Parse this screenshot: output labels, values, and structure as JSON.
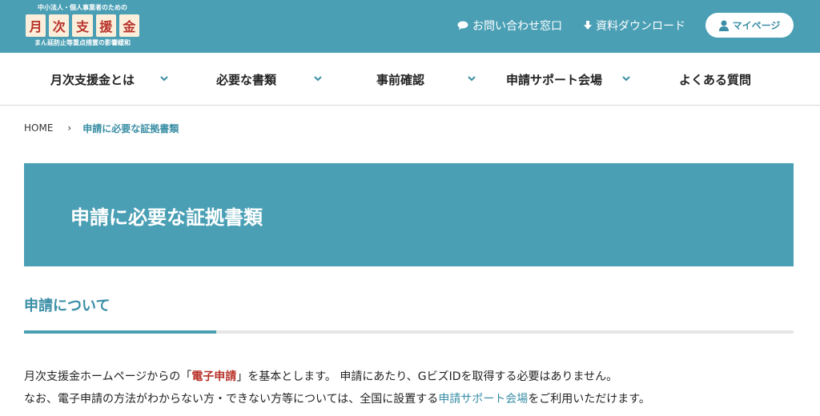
{
  "header": {
    "logo": {
      "top_text": "中小法人・個人事業者のための",
      "chars": [
        "月",
        "次",
        "支",
        "援",
        "金"
      ],
      "bottom_text": "まん延防止等重点措置の影響緩和"
    },
    "contact_label": "お問い合わせ窓口",
    "download_label": "資料ダウンロード",
    "mypage_label": "マイページ"
  },
  "nav": {
    "items": [
      {
        "label": "月次支援金とは",
        "has_dropdown": true
      },
      {
        "label": "必要な書類",
        "has_dropdown": true
      },
      {
        "label": "事前確認",
        "has_dropdown": true
      },
      {
        "label": "申請サポート会場",
        "has_dropdown": true
      },
      {
        "label": "よくある質問",
        "has_dropdown": false
      }
    ]
  },
  "breadcrumb": {
    "home": "HOME",
    "separator": "›",
    "current": "申請に必要な証拠書類"
  },
  "banner": {
    "title": "申請に必要な証拠書類"
  },
  "section": {
    "title": "申請について",
    "para1": {
      "before": "月次支援金ホームページからの「",
      "emphasis": "電子申請",
      "after": "」を基本とします。 申請にあたり、GビズIDを取得する必要はありません。"
    },
    "para2": {
      "before": "なお、電子申請の方法がわからない方・できない方等については、全国に設置する",
      "link": "申請サポート会場",
      "after": "をご利用いただけます。"
    }
  },
  "colors": {
    "brand_teal": "#4a9fb5",
    "accent_red": "#b8322a",
    "link_teal": "#3a8ea5"
  }
}
